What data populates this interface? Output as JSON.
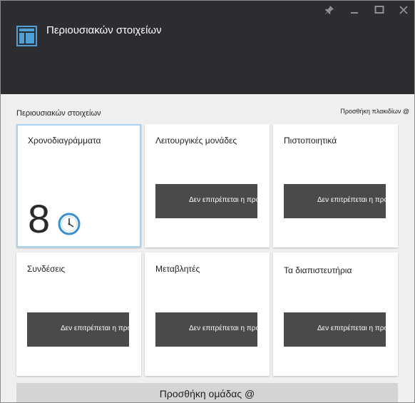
{
  "header": {
    "title": "Περιουσιακών στοιχείων",
    "icon": "blade-icon"
  },
  "window_controls": {
    "pin": "⚑",
    "minimize": "—",
    "maximize": "□",
    "close": "✕"
  },
  "section": {
    "label": "Περιουσιακών στοιχείων",
    "add_tiles_label": "Προσθήκη πλακιδίων @"
  },
  "tiles": [
    {
      "title": "Χρονοδιαγράμματα",
      "count": "8",
      "icon": "clock-icon"
    },
    {
      "title": "Λειτουργικές μονάδες",
      "message": "Δεν επιτρέπεται η πρόσβαση"
    },
    {
      "title": "Πιστοποιητικά",
      "message": "Δεν επιτρέπεται η πρόσβαση"
    },
    {
      "title": "Συνδέσεις",
      "message": "Δεν επιτρέπεται η πρόσβαση"
    },
    {
      "title": "Μεταβλητές",
      "message": "Δεν επιτρέπεται η πρόσβαση"
    },
    {
      "title": "Τα διαπιστευτήρια",
      "message": "Δεν επιτρέπεται η πρόσβαση"
    }
  ],
  "footer": {
    "add_group_label": "Προσθήκη ομάδας @"
  },
  "colors": {
    "header_bg": "#2b2d31",
    "accent": "#4ea1d8",
    "selected_border": "#a8d3f0",
    "na_block": "#4a4a4a",
    "page_bg": "#efefef"
  }
}
